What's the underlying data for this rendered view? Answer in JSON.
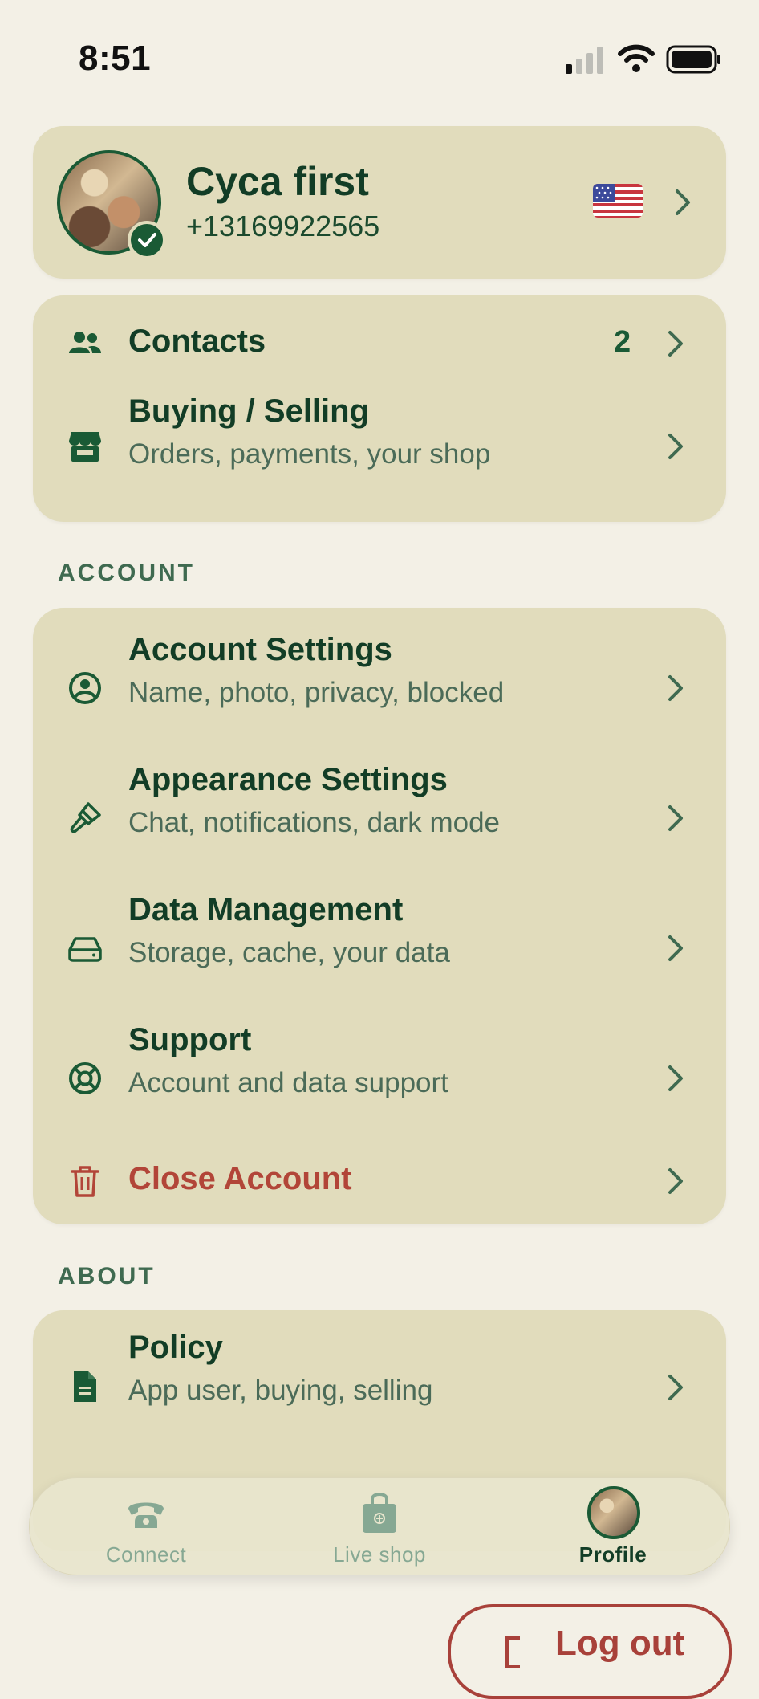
{
  "status_bar": {
    "time": "8:51"
  },
  "profile": {
    "name": "Cyca first",
    "phone": "+13169922565",
    "flag_icon": "us-flag-icon"
  },
  "quick": {
    "contacts": {
      "label": "Contacts",
      "count": "2",
      "icon": "contacts-icon"
    },
    "buying": {
      "label": "Buying / Selling",
      "subtitle": "Orders, payments, your shop",
      "icon": "shop-icon"
    }
  },
  "account": {
    "heading": "ACCOUNT",
    "items": [
      {
        "label": "Account Settings",
        "subtitle": "Name, photo, privacy, blocked",
        "icon": "user-circle-icon"
      },
      {
        "label": "Appearance Settings",
        "subtitle": "Chat, notifications, dark mode",
        "icon": "paintbrush-icon"
      },
      {
        "label": "Data Management",
        "subtitle": "Storage, cache, your data",
        "icon": "hard-drive-icon"
      },
      {
        "label": "Support",
        "subtitle": "Account and data support",
        "icon": "lifebuoy-icon"
      },
      {
        "label": "Close Account",
        "subtitle": "",
        "icon": "trash-icon"
      }
    ]
  },
  "about": {
    "heading": "ABOUT",
    "items": [
      {
        "label": "Policy",
        "subtitle": "App user, buying, selling",
        "icon": "document-icon"
      }
    ]
  },
  "tabbar": {
    "tabs": [
      {
        "label": "Connect",
        "icon": "phone-chat-icon",
        "active": false
      },
      {
        "label": "Live shop",
        "icon": "shopping-bag-icon",
        "active": false
      },
      {
        "label": "Profile",
        "icon": "profile-avatar",
        "active": true
      }
    ]
  },
  "logout": {
    "label": "Log out"
  },
  "colors": {
    "accent": "#123d26",
    "card": "#e1dcbc",
    "background": "#f3f0e6",
    "danger": "#a8413a"
  }
}
